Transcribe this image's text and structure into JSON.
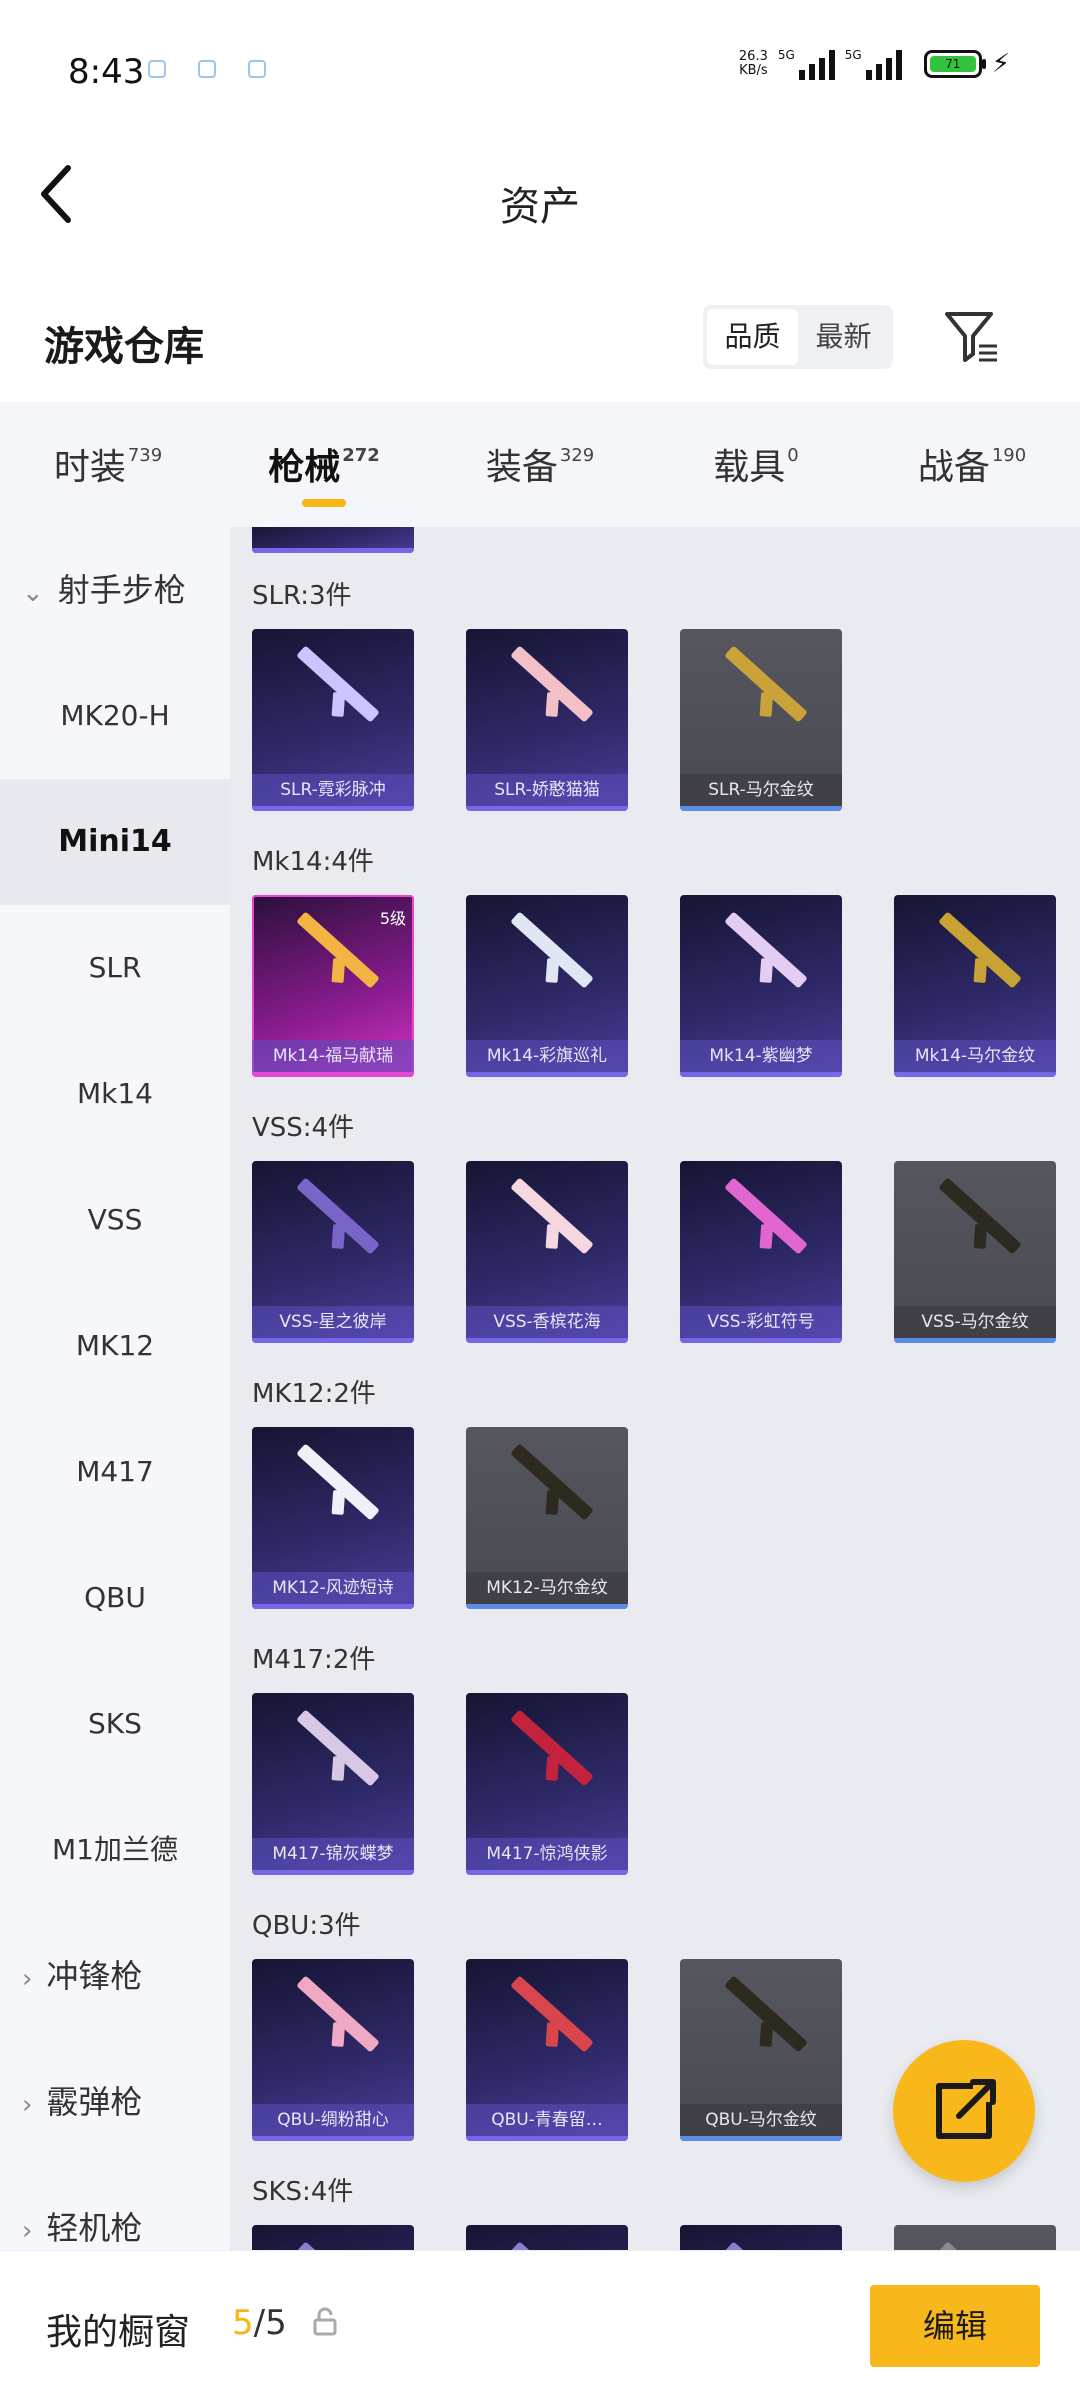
{
  "status_bar": {
    "time": "8:43",
    "net_speed_value": "26.3",
    "net_speed_unit": "KB/s",
    "signal1_tag": "5G",
    "signal2_tag": "5G",
    "battery_level": "71"
  },
  "header": {
    "title": "资产"
  },
  "warehouse": {
    "title": "游戏仓库",
    "sort_options": [
      "品质",
      "最新"
    ]
  },
  "tabs": [
    {
      "label": "时装",
      "count": "739"
    },
    {
      "label": "枪械",
      "count": "272"
    },
    {
      "label": "装备",
      "count": "329"
    },
    {
      "label": "载具",
      "count": "0"
    },
    {
      "label": "战备",
      "count": "190"
    }
  ],
  "sidebar": {
    "items": [
      {
        "label": "射手步枪",
        "type": "group-open"
      },
      {
        "label": "MK20-H",
        "type": "item"
      },
      {
        "label": "Mini14",
        "type": "selected"
      },
      {
        "label": "SLR",
        "type": "item"
      },
      {
        "label": "Mk14",
        "type": "item"
      },
      {
        "label": "VSS",
        "type": "item"
      },
      {
        "label": "MK12",
        "type": "item"
      },
      {
        "label": "M417",
        "type": "item"
      },
      {
        "label": "QBU",
        "type": "item"
      },
      {
        "label": "SKS",
        "type": "item"
      },
      {
        "label": "M1加兰德",
        "type": "item"
      },
      {
        "label": "冲锋枪",
        "type": "group"
      },
      {
        "label": "霰弹枪",
        "type": "group"
      },
      {
        "label": "轻机枪",
        "type": "group"
      }
    ]
  },
  "categories": [
    {
      "label": "SLR:3件",
      "items": [
        {
          "name": "SLR-霓彩脉冲",
          "style": "purple",
          "gun": "#c9c6ff"
        },
        {
          "name": "SLR-娇憨猫猫",
          "style": "purple",
          "gun": "#f4c0c8"
        },
        {
          "name": "SLR-马尔金纹",
          "style": "gray",
          "gun": "#caa23a"
        }
      ]
    },
    {
      "label": "Mk14:4件",
      "items": [
        {
          "name": "Mk14-福马献瑞",
          "style": "pink",
          "gun": "#f3b443",
          "level": "5级"
        },
        {
          "name": "Mk14-彩旗巡礼",
          "style": "purple",
          "gun": "#dfe6f4"
        },
        {
          "name": "Mk14-紫幽梦",
          "style": "purple",
          "gun": "#e4cdf2"
        },
        {
          "name": "Mk14-马尔金纹",
          "style": "purple",
          "gun": "#c9a235"
        }
      ]
    },
    {
      "label": "VSS:4件",
      "items": [
        {
          "name": "VSS-星之彼岸",
          "style": "purple",
          "gun": "#7b64c8"
        },
        {
          "name": "VSS-香槟花海",
          "style": "purple",
          "gun": "#f6d6df"
        },
        {
          "name": "VSS-彩虹符号",
          "style": "purple",
          "gun": "#e266d0"
        },
        {
          "name": "VSS-马尔金纹",
          "style": "gray",
          "gun": "#2d2a22"
        }
      ]
    },
    {
      "label": "MK12:2件",
      "items": [
        {
          "name": "MK12-风迹短诗",
          "style": "purple",
          "gun": "#eef1f8"
        },
        {
          "name": "MK12-马尔金纹",
          "style": "gray",
          "gun": "#2f2a1f"
        }
      ]
    },
    {
      "label": "M417:2件",
      "items": [
        {
          "name": "M417-锦灰蝶梦",
          "style": "purple",
          "gun": "#d7c9e6"
        },
        {
          "name": "M417-惊鸿侠影",
          "style": "purple",
          "gun": "#c3233c"
        }
      ]
    },
    {
      "label": "QBU:3件",
      "items": [
        {
          "name": "QBU-绸粉甜心",
          "style": "purple",
          "gun": "#f0a9c4"
        },
        {
          "name": "QBU-青春留…",
          "style": "purple",
          "gun": "#d8454c"
        },
        {
          "name": "QBU-马尔金纹",
          "style": "gray",
          "gun": "#2f2a1f"
        }
      ]
    },
    {
      "label": "SKS:4件",
      "items": [
        {
          "name": "",
          "style": "purple",
          "gun": "#8a7fd0"
        },
        {
          "name": "",
          "style": "purple",
          "gun": "#8a7fd0"
        },
        {
          "name": "",
          "style": "purple",
          "gun": "#8a7fd0"
        },
        {
          "name": "",
          "style": "gray",
          "gun": "#8a8a8a"
        }
      ]
    }
  ],
  "showcase": {
    "label": "我的橱窗",
    "count_current": "5",
    "count_total": "/5",
    "edit_label": "编辑"
  },
  "colors": {
    "accent": "#f7b614",
    "card_purple": "#302a6b",
    "card_gray": "#4e4f56"
  }
}
